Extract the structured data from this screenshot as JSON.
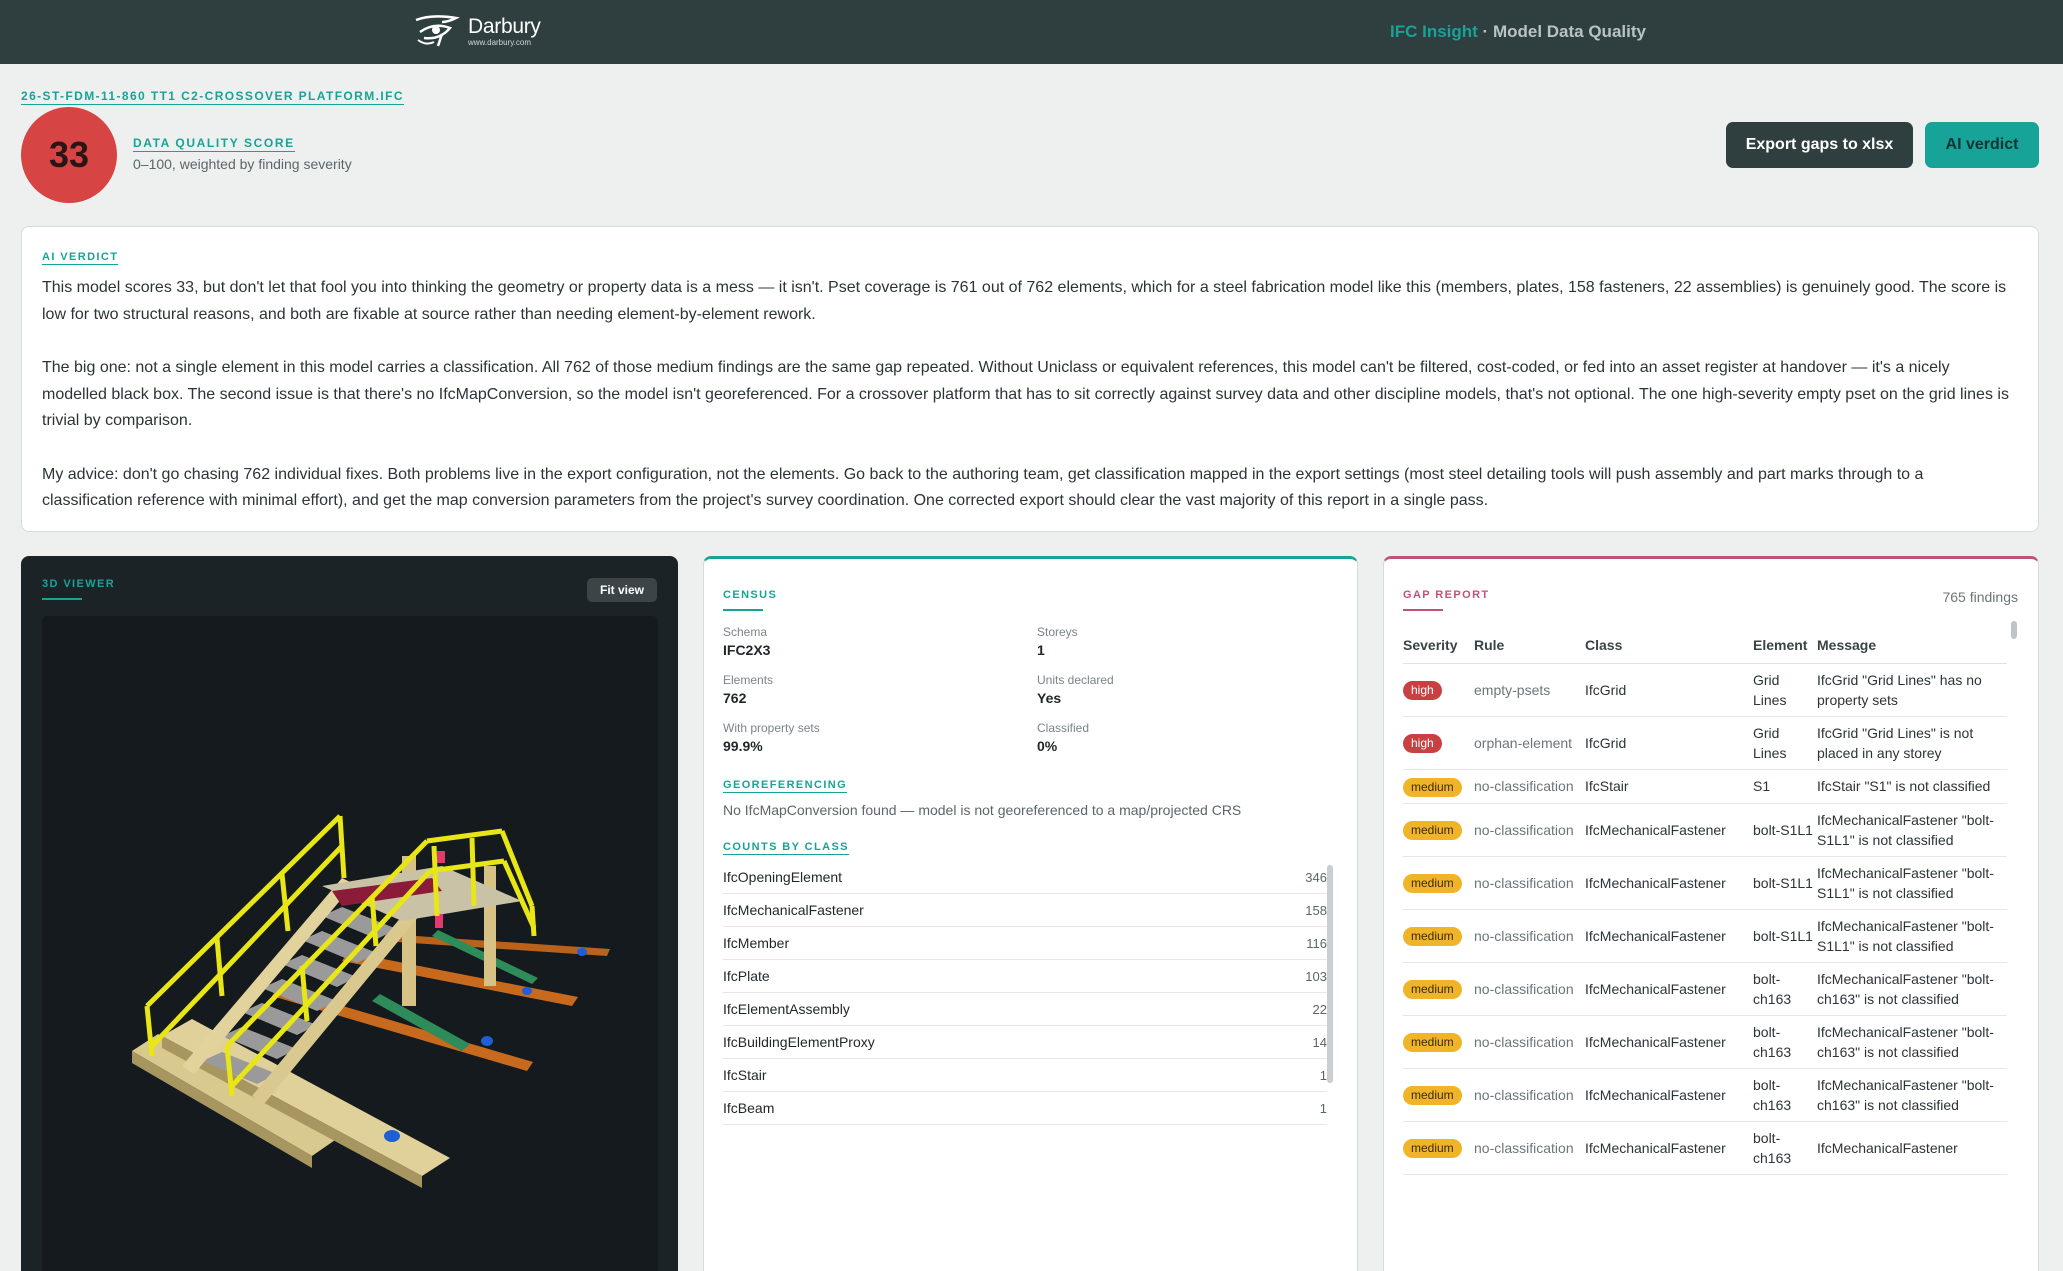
{
  "topbar": {
    "brand_name": "Darbury",
    "brand_url": "www.darbury.com",
    "product": "IFC Insight",
    "separator": " · ",
    "page_title": "Model Data Quality"
  },
  "header": {
    "file_name": "26-ST-FDM-11-860 TT1 C2-CROSSOVER PLATFORM.IFC",
    "score": "33",
    "score_label": "DATA QUALITY SCORE",
    "score_sub": "0–100, weighted by finding severity",
    "export_label": "Export gaps to xlsx",
    "verdict_label": "AI verdict"
  },
  "colors": {
    "accent": "#17a398",
    "score": "#d64543",
    "gap_accent": "#c1527a",
    "topbar": "#2f3e3f"
  },
  "verdict": {
    "tag": "AI VERDICT",
    "p1": "This model scores 33, but don't let that fool you into thinking the geometry or property data is a mess — it isn't. Pset coverage is 761 out of 762 elements, which for a steel fabrication model like this (members, plates, 158 fasteners, 22 assemblies) is genuinely good. The score is low for two structural reasons, and both are fixable at source rather than needing element-by-element rework.",
    "p2": "The big one: not a single element in this model carries a classification. All 762 of those medium findings are the same gap repeated. Without Uniclass or equivalent references, this model can't be filtered, cost-coded, or fed into an asset register at handover — it's a nicely modelled black box. The second issue is that there's no IfcMapConversion, so the model isn't georeferenced. For a crossover platform that has to sit correctly against survey data and other discipline models, that's not optional. The one high-severity empty pset on the grid lines is trivial by comparison.",
    "p3": "My advice: don't go chasing 762 individual fixes. Both problems live in the export configuration, not the elements. Go back to the authoring team, get classification mapped in the export settings (most steel detailing tools will push assembly and part marks through to a classification reference with minimal effort), and get the map conversion parameters from the project's survey coordination. One corrected export should clear the vast majority of this report in a single pass."
  },
  "viewer": {
    "tag": "3D VIEWER",
    "fit_label": "Fit view"
  },
  "census": {
    "tag": "CENSUS",
    "schema_k": "Schema",
    "schema_v": "IFC2X3",
    "storeys_k": "Storeys",
    "storeys_v": "1",
    "elements_k": "Elements",
    "elements_v": "762",
    "units_k": "Units declared",
    "units_v": "Yes",
    "psets_k": "With property sets",
    "psets_v": "99.9%",
    "classified_k": "Classified",
    "classified_v": "0%",
    "geo_tag": "GEOREFERENCING",
    "geo_text": "No IfcMapConversion found — model is not georeferenced to a map/projected CRS",
    "counts_tag": "COUNTS BY CLASS",
    "counts": [
      {
        "cls": "IfcOpeningElement",
        "n": "346"
      },
      {
        "cls": "IfcMechanicalFastener",
        "n": "158"
      },
      {
        "cls": "IfcMember",
        "n": "116"
      },
      {
        "cls": "IfcPlate",
        "n": "103"
      },
      {
        "cls": "IfcElementAssembly",
        "n": "22"
      },
      {
        "cls": "IfcBuildingElementProxy",
        "n": "14"
      },
      {
        "cls": "IfcStair",
        "n": "1"
      },
      {
        "cls": "IfcBeam",
        "n": "1"
      }
    ]
  },
  "gap": {
    "tag": "GAP REPORT",
    "findings": "765 findings",
    "headers": {
      "severity": "Severity",
      "rule": "Rule",
      "class": "Class",
      "element": "Element",
      "message": "Message"
    },
    "rows": [
      {
        "sev": "high",
        "rule": "empty-psets",
        "cls": "IfcGrid",
        "el": "Grid Lines",
        "msg": "IfcGrid \"Grid Lines\" has no property sets"
      },
      {
        "sev": "high",
        "rule": "orphan-element",
        "cls": "IfcGrid",
        "el": "Grid Lines",
        "msg": "IfcGrid \"Grid Lines\" is not placed in any storey"
      },
      {
        "sev": "medium",
        "rule": "no-classification",
        "cls": "IfcStair",
        "el": "S1",
        "msg": "IfcStair \"S1\" is not classified"
      },
      {
        "sev": "medium",
        "rule": "no-classification",
        "cls": "IfcMechanicalFastener",
        "el": "bolt-S1L1",
        "msg": "IfcMechanicalFastener \"bolt-S1L1\" is not classified"
      },
      {
        "sev": "medium",
        "rule": "no-classification",
        "cls": "IfcMechanicalFastener",
        "el": "bolt-S1L1",
        "msg": "IfcMechanicalFastener \"bolt-S1L1\" is not classified"
      },
      {
        "sev": "medium",
        "rule": "no-classification",
        "cls": "IfcMechanicalFastener",
        "el": "bolt-S1L1",
        "msg": "IfcMechanicalFastener \"bolt-S1L1\" is not classified"
      },
      {
        "sev": "medium",
        "rule": "no-classification",
        "cls": "IfcMechanicalFastener",
        "el": "bolt-ch163",
        "msg": "IfcMechanicalFastener \"bolt-ch163\" is not classified"
      },
      {
        "sev": "medium",
        "rule": "no-classification",
        "cls": "IfcMechanicalFastener",
        "el": "bolt-ch163",
        "msg": "IfcMechanicalFastener \"bolt-ch163\" is not classified"
      },
      {
        "sev": "medium",
        "rule": "no-classification",
        "cls": "IfcMechanicalFastener",
        "el": "bolt-ch163",
        "msg": "IfcMechanicalFastener \"bolt-ch163\" is not classified"
      },
      {
        "sev": "medium",
        "rule": "no-classification",
        "cls": "IfcMechanicalFastener",
        "el": "bolt-ch163",
        "msg": "IfcMechanicalFastener"
      }
    ]
  }
}
